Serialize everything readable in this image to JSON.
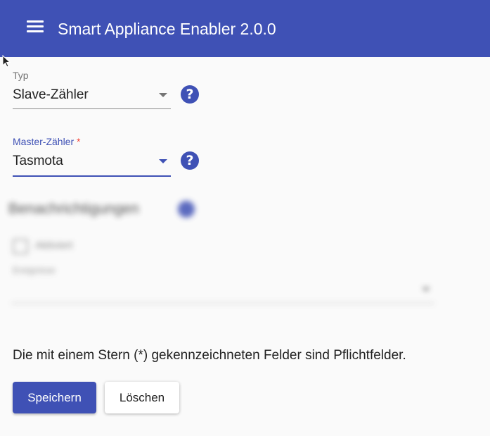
{
  "toolbar": {
    "menu_icon": "hamburger-menu-icon",
    "title": "Smart Appliance Enabler 2.0.0"
  },
  "colors": {
    "primary": "#3f51b5",
    "required": "#f44336",
    "background": "#fafafa"
  },
  "form": {
    "typ": {
      "label": "Typ",
      "value": "Slave-Zähler",
      "help_icon": "question-circle-icon"
    },
    "master": {
      "label": "Master-Zähler",
      "required_marker": "*",
      "value": "Tasmota",
      "help_icon": "question-circle-icon"
    },
    "notifications": {
      "title": "Benachrichtigungen",
      "checkbox_label": "Aktiviert",
      "select_label": "Ereignisse"
    },
    "hint": "Die mit einem Stern (*) gekennzeichneten Felder sind Pflichtfelder.",
    "save_label": "Speichern",
    "delete_label": "Löschen"
  }
}
